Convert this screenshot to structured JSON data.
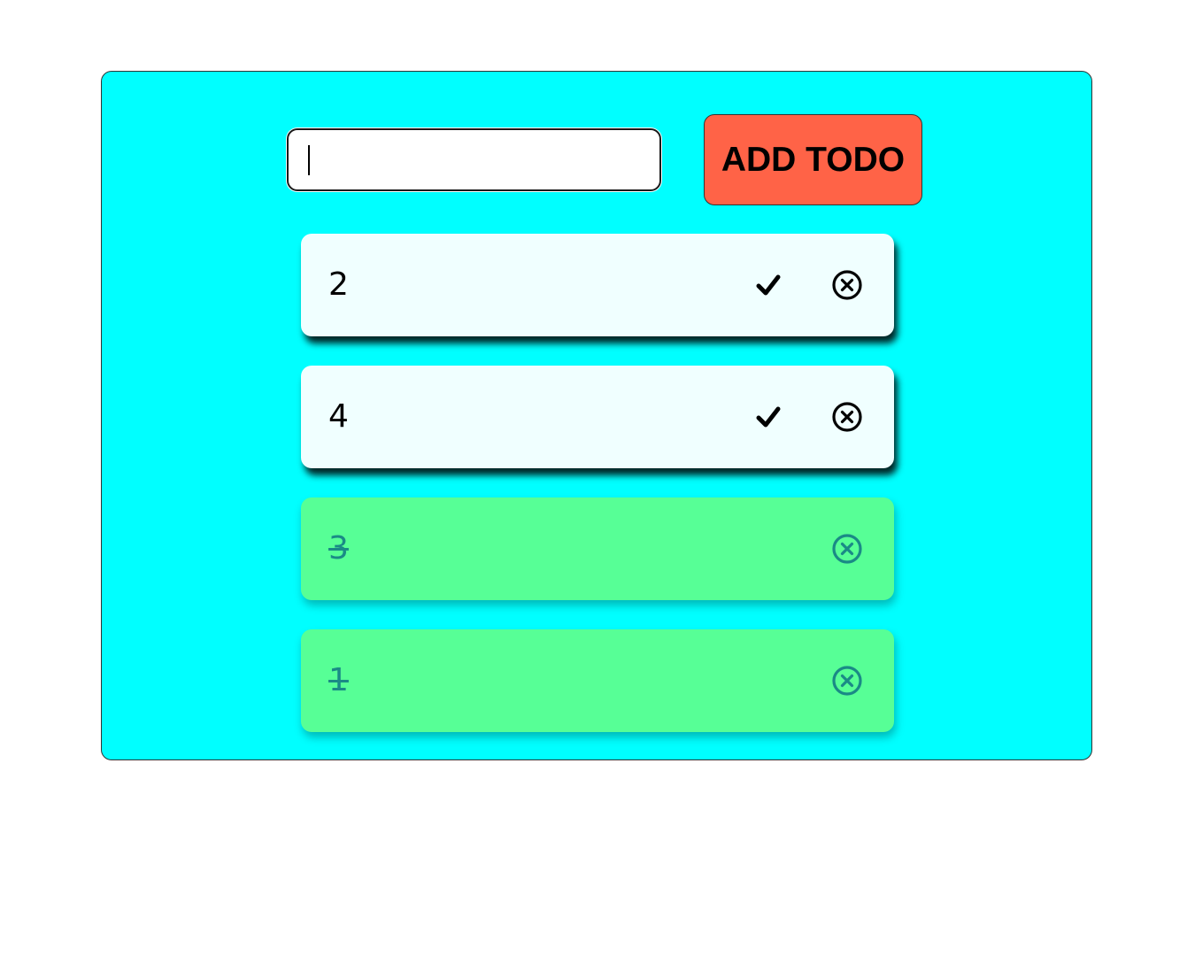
{
  "input": {
    "value": "",
    "placeholder": ""
  },
  "add_button": {
    "label": "ADD TODO"
  },
  "colors": {
    "panel_background": "#00ffff",
    "button_background": "#ff6347",
    "pending_item_background": "#f0ffff",
    "completed_item_background": "#57ff96",
    "completed_text": "#1a8a86"
  },
  "todos": [
    {
      "text": "2",
      "completed": false,
      "icons": [
        "check-icon",
        "close-circle-icon"
      ]
    },
    {
      "text": "4",
      "completed": false,
      "icons": [
        "check-icon",
        "close-circle-icon"
      ]
    },
    {
      "text": "3",
      "completed": true,
      "icons": [
        "close-circle-icon"
      ]
    },
    {
      "text": "1",
      "completed": true,
      "icons": [
        "close-circle-icon"
      ]
    }
  ]
}
